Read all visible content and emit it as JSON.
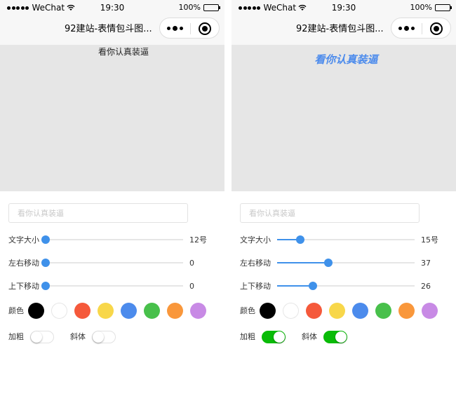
{
  "status_bar": {
    "carrier": "WeChat",
    "time": "19:30",
    "battery": "100%"
  },
  "nav": {
    "title": "92建站-表情包斗图..."
  },
  "colors": {
    "accent": "#3f91ea",
    "switch_on": "#09bb07",
    "palette": [
      "#000000",
      "#ffffff",
      "#f5593b",
      "#f8d74a",
      "#4c8bec",
      "#48c04b",
      "#f9973b",
      "#c88ae5"
    ]
  },
  "screens": [
    {
      "canvas_text": "看你认真装逼",
      "input": {
        "value": "",
        "placeholder": "看你认真装逼"
      },
      "sliders": [
        {
          "label": "文字大小",
          "value": 12,
          "display": "12号",
          "fraction": 0.0
        },
        {
          "label": "左右移动",
          "value": 0,
          "display": "0",
          "fraction": 0.0
        },
        {
          "label": "上下移动",
          "value": 0,
          "display": "0",
          "fraction": 0.0
        }
      ],
      "color_label": "颜色",
      "bold_label": "加粗",
      "bold_on": false,
      "italic_label": "斜体",
      "italic_on": false
    },
    {
      "canvas_text": "看你认真装逼",
      "input": {
        "value": "",
        "placeholder": "看你认真装逼"
      },
      "sliders": [
        {
          "label": "文字大小",
          "value": 15,
          "display": "15号",
          "fraction": 0.17
        },
        {
          "label": "左右移动",
          "value": 37,
          "display": "37",
          "fraction": 0.37
        },
        {
          "label": "上下移动",
          "value": 26,
          "display": "26",
          "fraction": 0.26
        }
      ],
      "color_label": "颜色",
      "bold_label": "加粗",
      "bold_on": true,
      "italic_label": "斜体",
      "italic_on": true
    }
  ]
}
